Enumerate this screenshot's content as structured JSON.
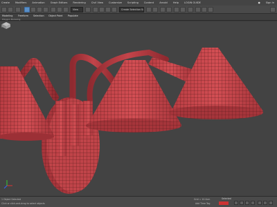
{
  "menu": {
    "items": [
      "Create",
      "Modifiers",
      "Animation",
      "Graph Editors",
      "Rendering",
      "Civil View",
      "Customize",
      "Scripting",
      "Content",
      "Arnold",
      "Help",
      "LOGIN GUIDE"
    ],
    "sign_in": "Sign in",
    "workspace": "Workspaces"
  },
  "toolbar": {
    "selection_filter": "All",
    "named_selection": "Create Selection Se",
    "view_mode": "View"
  },
  "ribbon": {
    "tabs": [
      "Modeling",
      "Freeform",
      "Selection",
      "Object Paint",
      "Populate"
    ],
    "sub_label": "Polygon Modeling"
  },
  "viewport": {
    "label": "[+] [Perspective] [Standard] [Edged Faces]",
    "label_short": "[+]"
  },
  "status": {
    "left_text": "1 Object Selected",
    "prompt": "Click or click-and-drag to select objects",
    "x": "X: 0.0",
    "y": "Y: 0.0",
    "z": "Z: 0.0",
    "grid": "Grid = 10.0cm",
    "add_time_tag": "Add Time Tag",
    "selected": "Selected",
    "auto_key": "Auto Key"
  },
  "colors": {
    "accent": "#5a8fc7",
    "mesh": "#c8444a",
    "wire": "#3b1a1a",
    "viewport_bg": "#434343"
  }
}
